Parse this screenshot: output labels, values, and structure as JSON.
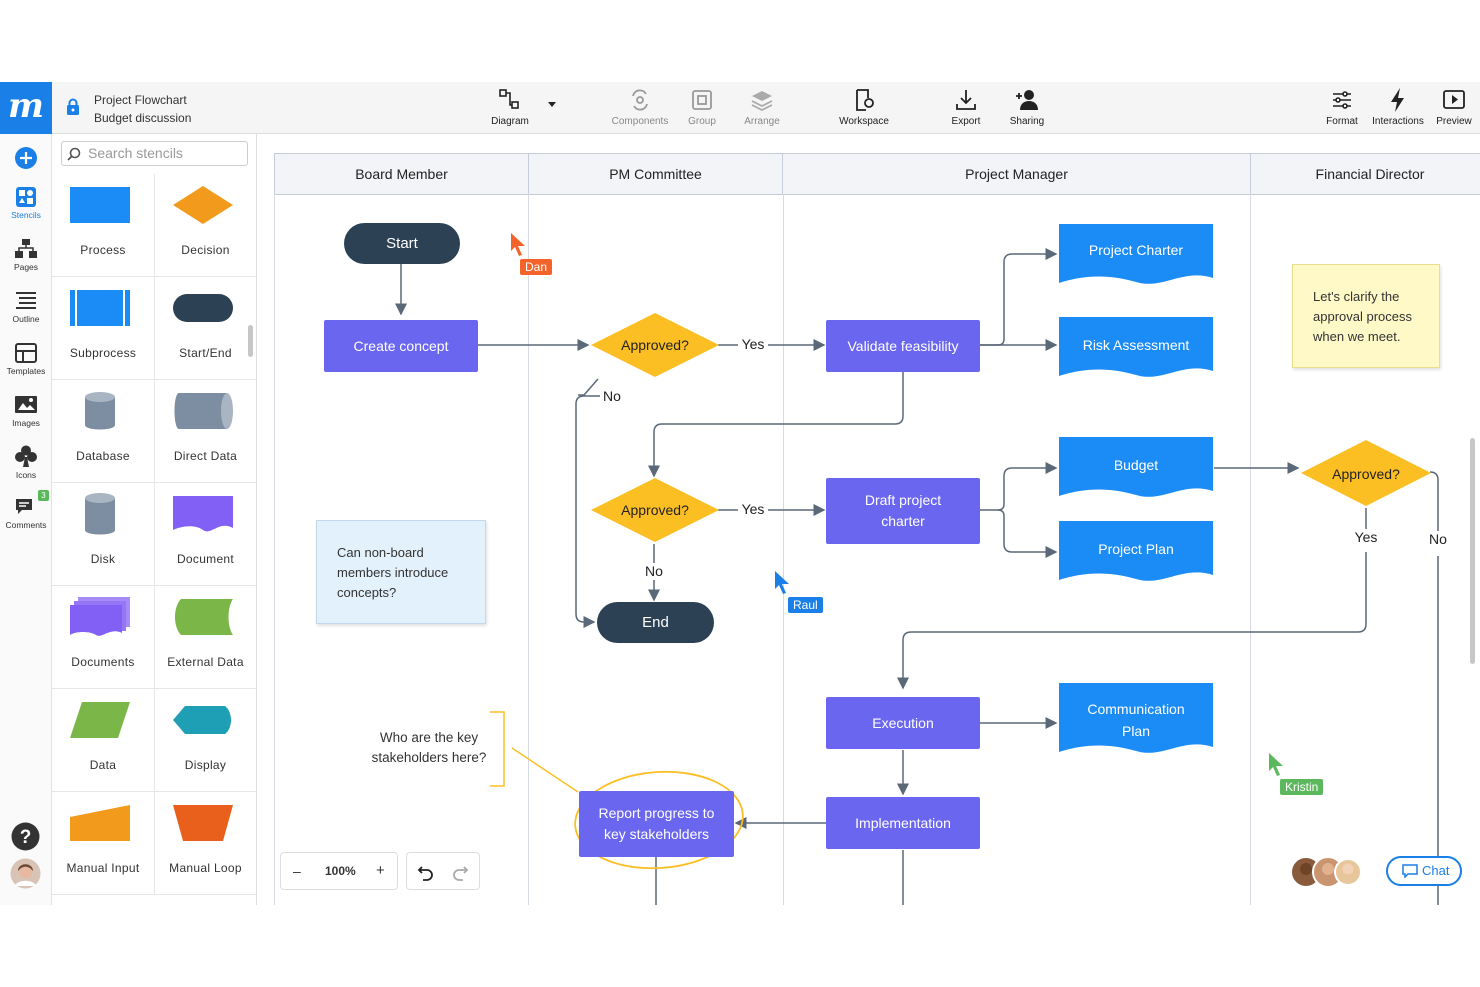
{
  "document": {
    "title": "Project Flowchart",
    "subtitle": "Budget discussion"
  },
  "toolbar": {
    "diagram": "Diagram",
    "components": "Components",
    "group": "Group",
    "arrange": "Arrange",
    "workspace": "Workspace",
    "export": "Export",
    "sharing": "Sharing",
    "format": "Format",
    "interactions": "Interactions",
    "preview": "Preview"
  },
  "rail": {
    "stencils": "Stencils",
    "pages": "Pages",
    "outline": "Outline",
    "templates": "Templates",
    "images": "Images",
    "icons": "Icons",
    "comments": "Comments",
    "comments_badge": "3"
  },
  "stencils": {
    "search_placeholder": "Search stencils",
    "items": [
      "Process",
      "Decision",
      "Subprocess",
      "Start/End",
      "Database",
      "Direct Data",
      "Disk",
      "Document",
      "Documents",
      "External Data",
      "Data",
      "Display",
      "Manual Input",
      "Manual Loop"
    ]
  },
  "lanes": [
    "Board Member",
    "PM Committee",
    "Project Manager",
    "Financial Director"
  ],
  "nodes": {
    "start": "Start",
    "create_concept": "Create concept",
    "approved1": "Approved?",
    "validate": "Validate feasibility",
    "project_charter": "Project Charter",
    "risk": "Risk Assessment",
    "approved2": "Approved?",
    "draft_1": "Draft project",
    "draft_2": "charter",
    "budget": "Budget",
    "project_plan": "Project Plan",
    "approved3": "Approved?",
    "end": "End",
    "execution": "Execution",
    "comm_1": "Communication",
    "comm_2": "Plan",
    "implementation": "Implementation",
    "report_1": "Report progress to",
    "report_2": "key stakeholders"
  },
  "edge_labels": {
    "yes1": "Yes",
    "no1": "No",
    "yes2": "Yes",
    "no2": "No",
    "yes3": "Yes",
    "no3": "No"
  },
  "notes": {
    "blue": [
      "Can non-board",
      "members introduce",
      "concepts?"
    ],
    "yellow": [
      "Let's clarify the",
      "approval process",
      "when we meet."
    ],
    "question": [
      "Who are the key",
      "stakeholders here?"
    ]
  },
  "cursors": {
    "dan": "Dan",
    "raul": "Raul",
    "kristin": "Kristin"
  },
  "zoom": {
    "level": "100%",
    "minus": "–",
    "plus": "+"
  },
  "chat": {
    "label": "Chat"
  },
  "colors": {
    "brand": "#1b7fe8",
    "process": "#6a66f0",
    "decision": "#fbbf24",
    "docshape": "#1b8cf5",
    "terminal": "#2d4154",
    "dan": "#f4642a",
    "raul": "#1b7fe8",
    "kristin": "#5cb85c"
  }
}
